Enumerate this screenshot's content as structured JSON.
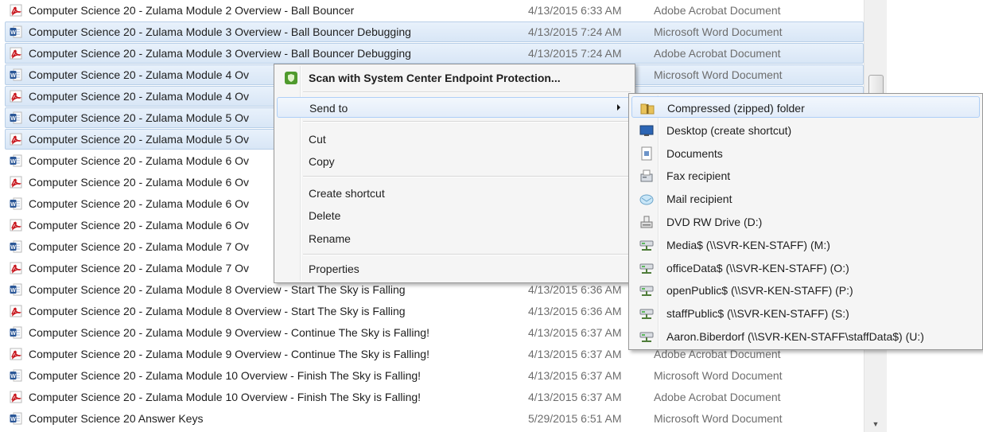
{
  "files": [
    {
      "icon": "pdf",
      "name": "Computer Science 20 - Zulama Module 2 Overview - Ball Bouncer",
      "date": "4/13/2015 6:33 AM",
      "type": "Adobe Acrobat Document",
      "selected": false
    },
    {
      "icon": "word",
      "name": "Computer Science 20 - Zulama Module 3 Overview - Ball Bouncer Debugging",
      "date": "4/13/2015 7:24 AM",
      "type": "Microsoft Word Document",
      "selected": true
    },
    {
      "icon": "pdf",
      "name": "Computer Science 20 - Zulama Module 3 Overview - Ball Bouncer Debugging",
      "date": "4/13/2015 7:24 AM",
      "type": "Adobe Acrobat Document",
      "selected": true
    },
    {
      "icon": "word",
      "name": "Computer Science 20 - Zulama Module 4 Ov",
      "date": "",
      "type": "Microsoft Word Document",
      "selected": true
    },
    {
      "icon": "pdf",
      "name": "Computer Science 20 - Zulama Module 4 Ov",
      "date": "",
      "type": "",
      "selected": true
    },
    {
      "icon": "word",
      "name": "Computer Science 20 - Zulama Module 5 Ov",
      "date": "",
      "type": "",
      "selected": true
    },
    {
      "icon": "pdf",
      "name": "Computer Science 20 - Zulama Module 5 Ov",
      "date": "",
      "type": "",
      "selected": true
    },
    {
      "icon": "word",
      "name": "Computer Science 20 - Zulama Module 6 Ov",
      "date": "",
      "type": "",
      "selected": false
    },
    {
      "icon": "pdf",
      "name": "Computer Science 20 - Zulama Module 6 Ov",
      "date": "",
      "type": "",
      "selected": false
    },
    {
      "icon": "word",
      "name": "Computer Science 20 - Zulama Module 6 Ov",
      "date": "",
      "type": "",
      "selected": false
    },
    {
      "icon": "pdf",
      "name": "Computer Science 20 - Zulama Module 6 Ov",
      "date": "",
      "type": "",
      "selected": false
    },
    {
      "icon": "word",
      "name": "Computer Science 20 - Zulama Module 7 Ov",
      "date": "",
      "type": "",
      "selected": false
    },
    {
      "icon": "pdf",
      "name": "Computer Science 20 - Zulama Module 7 Ov",
      "date": "",
      "type": "",
      "selected": false
    },
    {
      "icon": "word",
      "name": "Computer Science 20 - Zulama Module 8 Overview - Start The Sky is Falling",
      "date": "4/13/2015 6:36 AM",
      "type": "",
      "selected": false
    },
    {
      "icon": "pdf",
      "name": "Computer Science 20 - Zulama Module 8 Overview - Start The Sky is Falling",
      "date": "4/13/2015 6:36 AM",
      "type": "",
      "selected": false
    },
    {
      "icon": "word",
      "name": "Computer Science 20 - Zulama Module 9 Overview - Continue The Sky is Falling!",
      "date": "4/13/2015 6:37 AM",
      "type": "",
      "selected": false
    },
    {
      "icon": "pdf",
      "name": "Computer Science 20 - Zulama Module 9 Overview - Continue The Sky is Falling!",
      "date": "4/13/2015 6:37 AM",
      "type": "Adobe Acrobat Document",
      "selected": false
    },
    {
      "icon": "word",
      "name": "Computer Science 20 - Zulama Module 10 Overview - Finish The Sky is Falling!",
      "date": "4/13/2015 6:37 AM",
      "type": "Microsoft Word Document",
      "selected": false
    },
    {
      "icon": "pdf",
      "name": "Computer Science 20 - Zulama Module 10 Overview - Finish The Sky is Falling!",
      "date": "4/13/2015 6:37 AM",
      "type": "Adobe Acrobat Document",
      "selected": false
    },
    {
      "icon": "word",
      "name": "Computer Science 20 Answer Keys",
      "date": "5/29/2015 6:51 AM",
      "type": "Microsoft Word Document",
      "selected": false
    }
  ],
  "context_menu": {
    "scan_label": "Scan with System Center Endpoint Protection...",
    "send_to_label": "Send to",
    "cut_label": "Cut",
    "copy_label": "Copy",
    "create_shortcut_label": "Create shortcut",
    "delete_label": "Delete",
    "rename_label": "Rename",
    "properties_label": "Properties"
  },
  "send_to": [
    {
      "icon": "zip-folder-icon",
      "label": "Compressed (zipped) folder",
      "highlighted": true
    },
    {
      "icon": "desktop-icon",
      "label": "Desktop (create shortcut)",
      "highlighted": false
    },
    {
      "icon": "documents-icon",
      "label": "Documents",
      "highlighted": false
    },
    {
      "icon": "fax-icon",
      "label": "Fax recipient",
      "highlighted": false
    },
    {
      "icon": "mail-icon",
      "label": "Mail recipient",
      "highlighted": false
    },
    {
      "icon": "dvd-drive-icon",
      "label": "DVD RW Drive (D:)",
      "highlighted": false
    },
    {
      "icon": "network-drive-icon",
      "label": "Media$ (\\\\SVR-KEN-STAFF) (M:)",
      "highlighted": false
    },
    {
      "icon": "network-drive-icon",
      "label": "officeData$ (\\\\SVR-KEN-STAFF) (O:)",
      "highlighted": false
    },
    {
      "icon": "network-drive-icon",
      "label": "openPublic$ (\\\\SVR-KEN-STAFF) (P:)",
      "highlighted": false
    },
    {
      "icon": "network-drive-icon",
      "label": "staffPublic$ (\\\\SVR-KEN-STAFF) (S:)",
      "highlighted": false
    },
    {
      "icon": "network-drive-icon",
      "label": "Aaron.Biberdorf (\\\\SVR-KEN-STAFF\\staffData$) (U:)",
      "highlighted": false
    }
  ],
  "colors": {
    "selection": "#d8e6f6",
    "menu_background": "#f5f5f5",
    "pdf_red": "#c8161d",
    "word_blue": "#2b5797"
  }
}
